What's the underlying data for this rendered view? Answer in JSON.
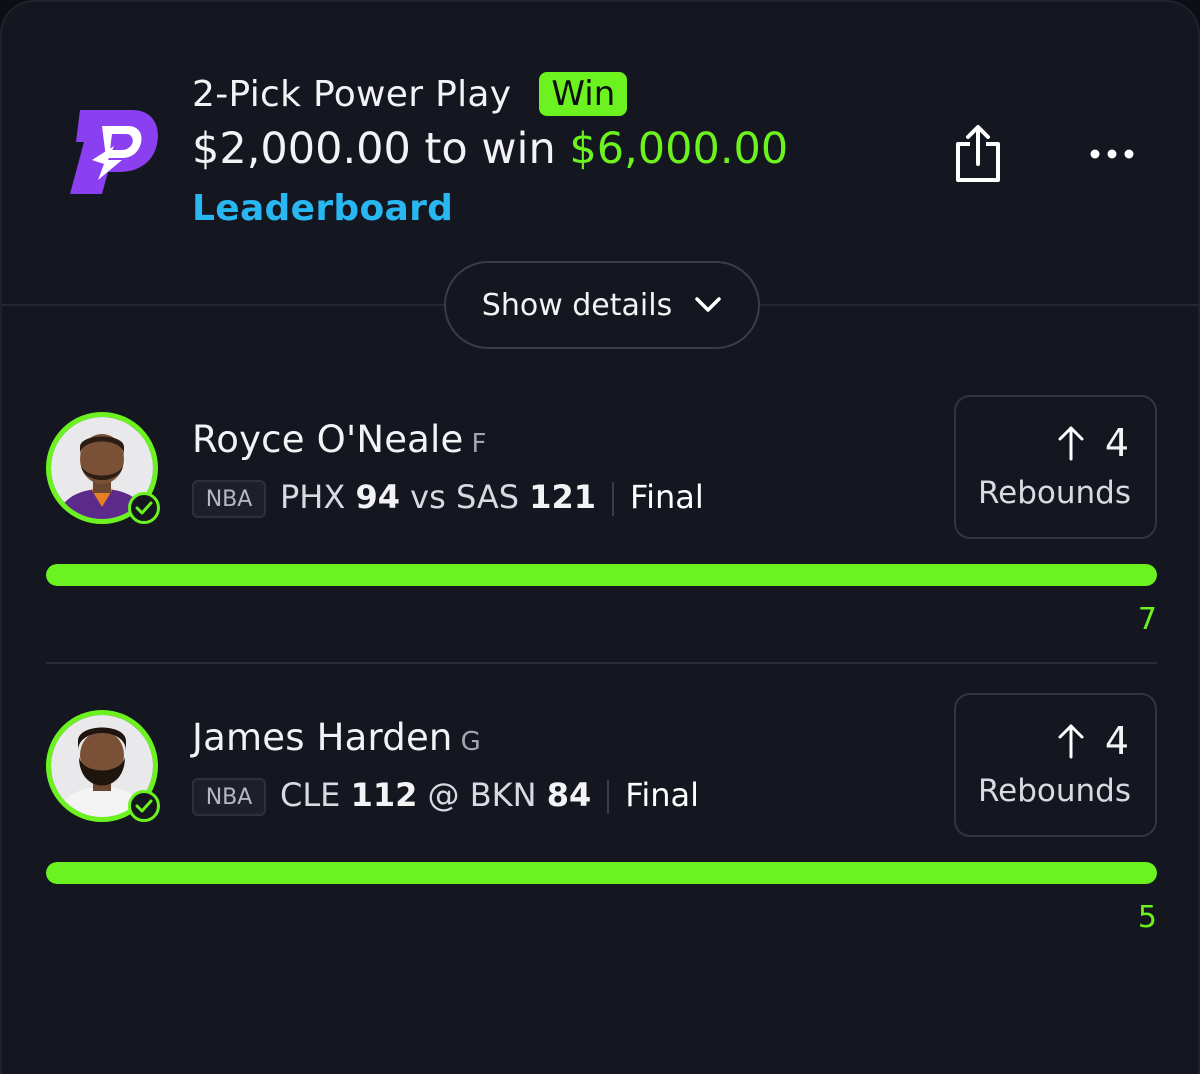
{
  "entry": {
    "title": "2-Pick Power Play",
    "result_badge": "Win",
    "stake": "$2,000.00",
    "to_win_text": "to win",
    "payout": "$6,000.00",
    "leaderboard_link": "Leaderboard",
    "details_button": "Show details"
  },
  "colors": {
    "accent_green": "#6cf21f",
    "link_blue": "#29b7f2",
    "brand_purple": "#8a3ff0",
    "background": "#151720"
  },
  "icons": {
    "logo": "prizepicks-logo-icon",
    "share": "share-icon",
    "more": "more-options-icon",
    "chevron": "chevron-down-icon",
    "arrow": "arrow-up-icon",
    "check": "check-circle-icon"
  },
  "picks": [
    {
      "player_name": "Royce O'Neale",
      "position": "F",
      "league": "NBA",
      "team1": "PHX",
      "score1": "94",
      "separator": "vs",
      "team2": "SAS",
      "score2": "121",
      "status": "Final",
      "line_value": "4",
      "stat_type": "Rebounds",
      "actual": "7",
      "progress": 1.0
    },
    {
      "player_name": "James Harden",
      "position": "G",
      "league": "NBA",
      "team1": "CLE",
      "score1": "112",
      "separator": "@",
      "team2": "BKN",
      "score2": "84",
      "status": "Final",
      "line_value": "4",
      "stat_type": "Rebounds",
      "actual": "5",
      "progress": 1.0
    }
  ]
}
